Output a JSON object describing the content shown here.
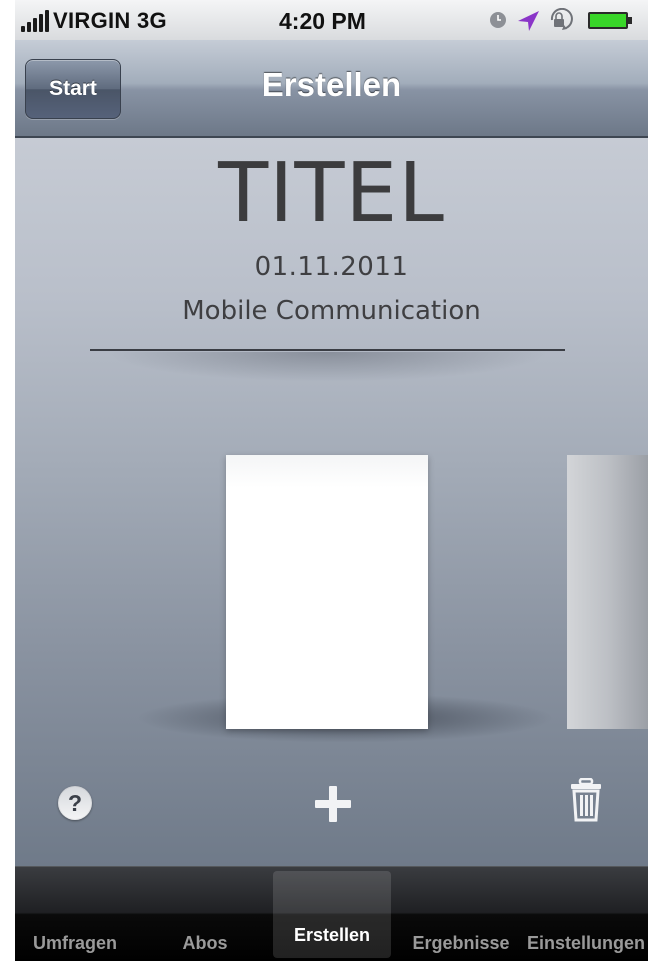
{
  "status_bar": {
    "carrier": "VIRGIN 3G",
    "time": "4:20 PM"
  },
  "nav": {
    "back_label": "Start",
    "title": "Erstellen"
  },
  "document": {
    "title": "TITEL",
    "date": "01.11.2011",
    "subtitle": "Mobile Communication"
  },
  "toolbar": {
    "help_label": "?"
  },
  "tabs": [
    {
      "label": "Umfragen",
      "selected": false
    },
    {
      "label": "Abos",
      "selected": false
    },
    {
      "label": "Erstellen",
      "selected": true
    },
    {
      "label": "Ergebnisse",
      "selected": false
    },
    {
      "label": "Einstellungen",
      "selected": false
    }
  ],
  "colors": {
    "nav_bar": "#8893a4",
    "content_top": "#c6cbd4",
    "content_bottom": "#6f7a89",
    "tab_bar": "#000000",
    "location_arrow": "#8a35c8",
    "battery": "#39d629"
  },
  "icons": [
    "signal-icon",
    "clock-icon",
    "location-icon",
    "rotation-lock-icon",
    "battery-icon",
    "help-icon",
    "plus-icon",
    "trash-icon"
  ]
}
